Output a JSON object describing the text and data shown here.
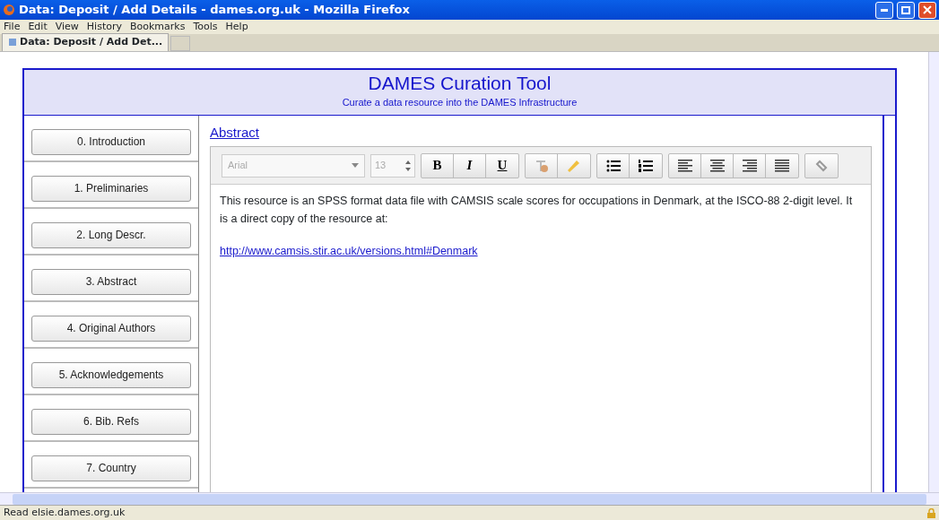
{
  "window": {
    "title": "Data: Deposit / Add Details - dames.org.uk - Mozilla Firefox"
  },
  "menu": [
    "File",
    "Edit",
    "View",
    "History",
    "Bookmarks",
    "Tools",
    "Help"
  ],
  "tabs": [
    {
      "label": "Data: Deposit / Add Det...",
      "selected": true
    }
  ],
  "header": {
    "title": "DAMES Curation Tool",
    "subtitle": "Curate a data resource into the DAMES Infrastructure"
  },
  "sidebar": {
    "items": [
      "0. Introduction",
      "1. Preliminaries",
      "2. Long Descr.",
      "3. Abstract",
      "4. Original Authors",
      "5. Acknowledgements",
      "6. Bib. Refs",
      "7. Country"
    ]
  },
  "section_link": "Abstract",
  "editor": {
    "font": {
      "value": "Arial",
      "disabled": true
    },
    "size": {
      "value": "13",
      "disabled": true
    },
    "format_buttons": [
      {
        "label": "B",
        "kind": "bold"
      },
      {
        "label": "I",
        "kind": "italic"
      },
      {
        "label": "U",
        "kind": "underline"
      }
    ],
    "paragraph": "This resource is an SPSS format data file with CAMSIS scale scores for occupations in Denmark, at the ISCO-88 2-digit level. It is a direct copy of the resource at:",
    "link": "http://www.camsis.stir.ac.uk/versions.html#Denmark"
  },
  "status_bar": "Read elsie.dames.org.uk"
}
